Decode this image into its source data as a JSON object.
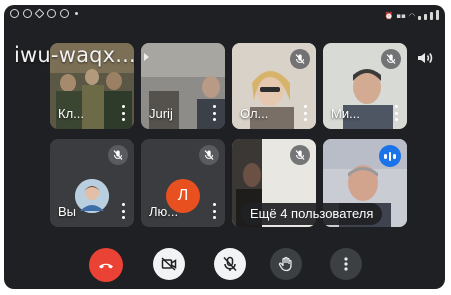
{
  "meeting": {
    "title": "iwu-waqx..."
  },
  "tiles": [
    {
      "name": "Кл...",
      "muted": false
    },
    {
      "name": "Jurij",
      "muted": false
    },
    {
      "name": "Ол...",
      "muted": true
    },
    {
      "name": "Ми...",
      "muted": true
    },
    {
      "name": "Вы",
      "muted": true,
      "avatar": "photo"
    },
    {
      "name": "Лю...",
      "muted": true,
      "avatar_letter": "Л"
    },
    {
      "name": "",
      "muted": true
    },
    {
      "name": "",
      "speaking": true
    }
  ],
  "overflow": {
    "label": "Ещё 4 пользователя"
  },
  "controls": {
    "hangup_icon": "phone-hangup-icon",
    "camera_icon": "camera-off-icon",
    "mic_icon": "mic-off-icon",
    "hand_icon": "raise-hand-icon",
    "more_icon": "more-vert-icon"
  },
  "colors": {
    "background": "#1f2023",
    "tile": "#3b3c3f",
    "hangup": "#ea4335",
    "accent_blue": "#1a73e8",
    "avatar_orange": "#e8501f"
  }
}
